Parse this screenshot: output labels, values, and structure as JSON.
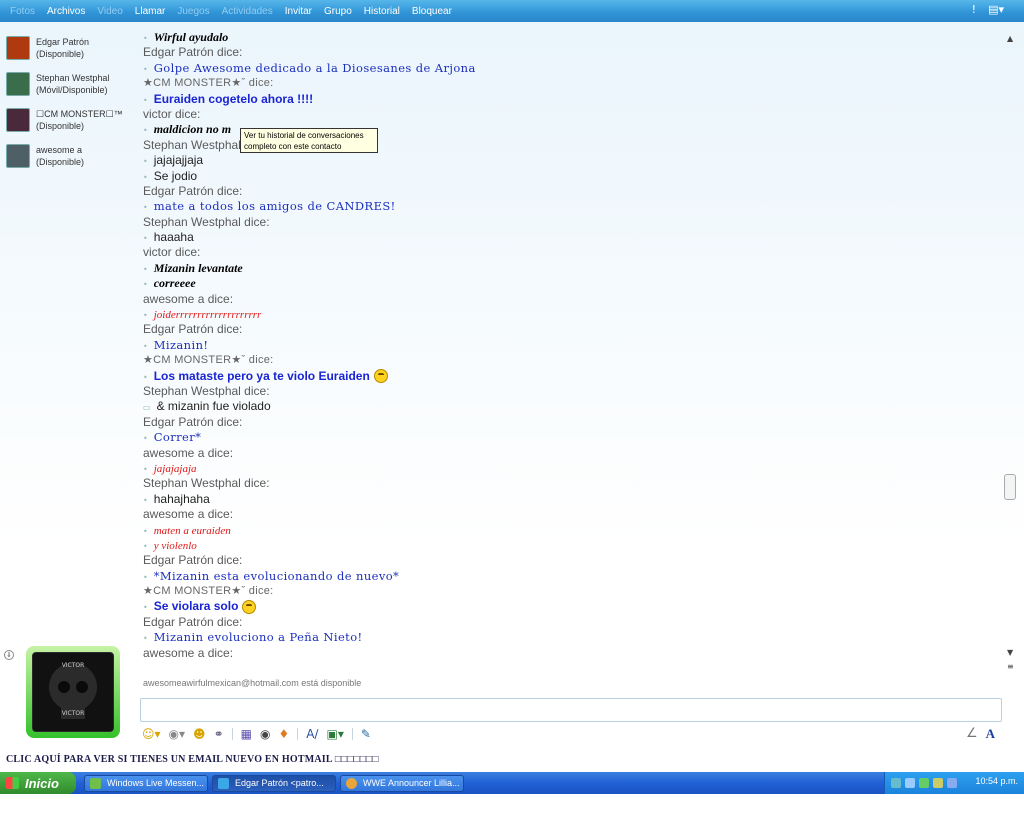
{
  "menu": {
    "items": [
      {
        "label": "Fotos",
        "dim": true
      },
      {
        "label": "Archivos",
        "dim": false
      },
      {
        "label": "Video",
        "dim": true
      },
      {
        "label": "Llamar",
        "dim": false
      },
      {
        "label": "Juegos",
        "dim": true
      },
      {
        "label": "Actividades",
        "dim": true
      },
      {
        "label": "Invitar",
        "dim": false
      },
      {
        "label": "Grupo",
        "dim": false
      },
      {
        "label": "Historial",
        "dim": false
      },
      {
        "label": "Bloquear",
        "dim": false
      }
    ],
    "alert_icon": "exclamation-icon",
    "options_icon": "menu-options-icon"
  },
  "contacts": [
    {
      "name": "Edgar Patrón",
      "status": "(Disponible)",
      "avatar_color": "#b03a10"
    },
    {
      "name": "Stephan Westphal",
      "status": "(Móvil/Disponible)",
      "avatar_color": "#3a6e4a"
    },
    {
      "name": "☐CM MONSTER☐™",
      "status": "(Disponible)",
      "avatar_color": "#4a2a3a"
    },
    {
      "name": "awesome a",
      "status": "(Disponible)",
      "avatar_color": "#4f5f66"
    }
  ],
  "conversation": [
    {
      "kind": "msg",
      "style": "s-bold-black",
      "text": "Wirful ayudalo"
    },
    {
      "kind": "spk",
      "text": "Edgar Patrón dice:"
    },
    {
      "kind": "msg",
      "style": "s-blue-deco",
      "text": "Golpe Awesome dedicado a la Diosesanes de Arjona"
    },
    {
      "kind": "spk",
      "monster": true,
      "text": "★CM MONSTER★ˇ dice:"
    },
    {
      "kind": "msg",
      "style": "s-blue-bold",
      "text": "Euraiden cogetelo ahora !!!!"
    },
    {
      "kind": "spk",
      "text": "victor dice:"
    },
    {
      "kind": "msg",
      "style": "s-bold-black",
      "text": "maldicion no m"
    },
    {
      "kind": "spk",
      "text": "Stephan Westphal"
    },
    {
      "kind": "msg",
      "style": "s-plain",
      "text": "jajajajjaja"
    },
    {
      "kind": "msg",
      "style": "s-plain",
      "text": "Se jodio"
    },
    {
      "kind": "spk",
      "text": "Edgar Patrón dice:"
    },
    {
      "kind": "msg",
      "style": "s-blue-deco",
      "text": "mate a todos los amigos de CANDRES!"
    },
    {
      "kind": "spk",
      "text": "Stephan Westphal dice:"
    },
    {
      "kind": "msg",
      "style": "s-plain",
      "text": "haaaha"
    },
    {
      "kind": "spk",
      "text": "victor dice:"
    },
    {
      "kind": "msg",
      "style": "s-bold-black",
      "text": "Mizanin levantate"
    },
    {
      "kind": "msg",
      "style": "s-bold-black",
      "text": "correeee"
    },
    {
      "kind": "spk",
      "text": "awesome a dice:"
    },
    {
      "kind": "msg",
      "style": "s-red-italic",
      "text": "joiderrrrrrrrrrrrrrrrrrrr"
    },
    {
      "kind": "spk",
      "text": "Edgar Patrón dice:"
    },
    {
      "kind": "msg",
      "style": "s-blue-deco",
      "text": "Mizanin!"
    },
    {
      "kind": "spk",
      "monster": true,
      "text": "★CM MONSTER★ˇ dice:"
    },
    {
      "kind": "msg",
      "style": "s-blue-bold",
      "text": "Los mataste pero ya te violo Euraiden",
      "emoticon": true
    },
    {
      "kind": "spk",
      "text": "Stephan Westphal dice:"
    },
    {
      "kind": "msg",
      "style": "s-plain",
      "bullet": "▭",
      "text": "& mizanin fue violado"
    },
    {
      "kind": "spk",
      "text": "Edgar Patrón dice:"
    },
    {
      "kind": "msg",
      "style": "s-blue-deco",
      "text": "Correr*"
    },
    {
      "kind": "spk",
      "text": "awesome a dice:"
    },
    {
      "kind": "msg",
      "style": "s-red-italic",
      "text": "jajajajaja"
    },
    {
      "kind": "spk",
      "text": "Stephan Westphal dice:"
    },
    {
      "kind": "msg",
      "style": "s-plain",
      "text": "hahajhaha"
    },
    {
      "kind": "spk",
      "text": "awesome a dice:"
    },
    {
      "kind": "msg",
      "style": "s-red-italic",
      "text": "maten a euraiden"
    },
    {
      "kind": "msg",
      "style": "s-red-italic",
      "text": "y violenlo"
    },
    {
      "kind": "spk",
      "text": "Edgar Patrón dice:"
    },
    {
      "kind": "msg",
      "style": "s-blue-deco",
      "text": "*Mizanin esta evolucionando de nuevo*"
    },
    {
      "kind": "spk",
      "monster": true,
      "text": "★CM MONSTER★ˇ dice:"
    },
    {
      "kind": "msg",
      "style": "s-blue-bold",
      "text": "Se violara solo",
      "emoticon": true
    },
    {
      "kind": "spk",
      "text": "Edgar Patrón dice:"
    },
    {
      "kind": "msg",
      "style": "s-blue-deco",
      "text": "Mizanin evoluciono a Peña Nieto!"
    },
    {
      "kind": "spk",
      "text": "awesome a dice:"
    }
  ],
  "tooltip": {
    "text": "Ver tu historial de conversaciones completo con este contacto"
  },
  "status_line": "awesomeawirfulmexican@hotmail.com está disponible",
  "display_picture": {
    "text_repeat": "VICTOR"
  },
  "input": {
    "placeholder": ""
  },
  "toolbar": {
    "icons": [
      "emoticon-icon",
      "wink-icon",
      "nudge-icon",
      "voice-clip-icon",
      "background-icon",
      "games-icon",
      "send-file-icon",
      "font-icon",
      "image-icon",
      "handwriting-mode-icon"
    ]
  },
  "promo_text": "CLIC AQUÍ PARA VER SI TIENES UN EMAIL NUEVO EN HOTMAIL  □□□□□□□",
  "taskbar": {
    "start_label": "Inicio",
    "tasks": [
      {
        "label": "Windows Live Messen...",
        "active": false,
        "icon_color": "#6fbf4a"
      },
      {
        "label": "Edgar Patrón <patro...",
        "active": true,
        "icon_color": "#3aa8e8"
      },
      {
        "label": "WWE Announcer Lillia...",
        "active": false,
        "icon_color": "#e8a53a"
      }
    ],
    "clock": "10:54 p.m."
  }
}
